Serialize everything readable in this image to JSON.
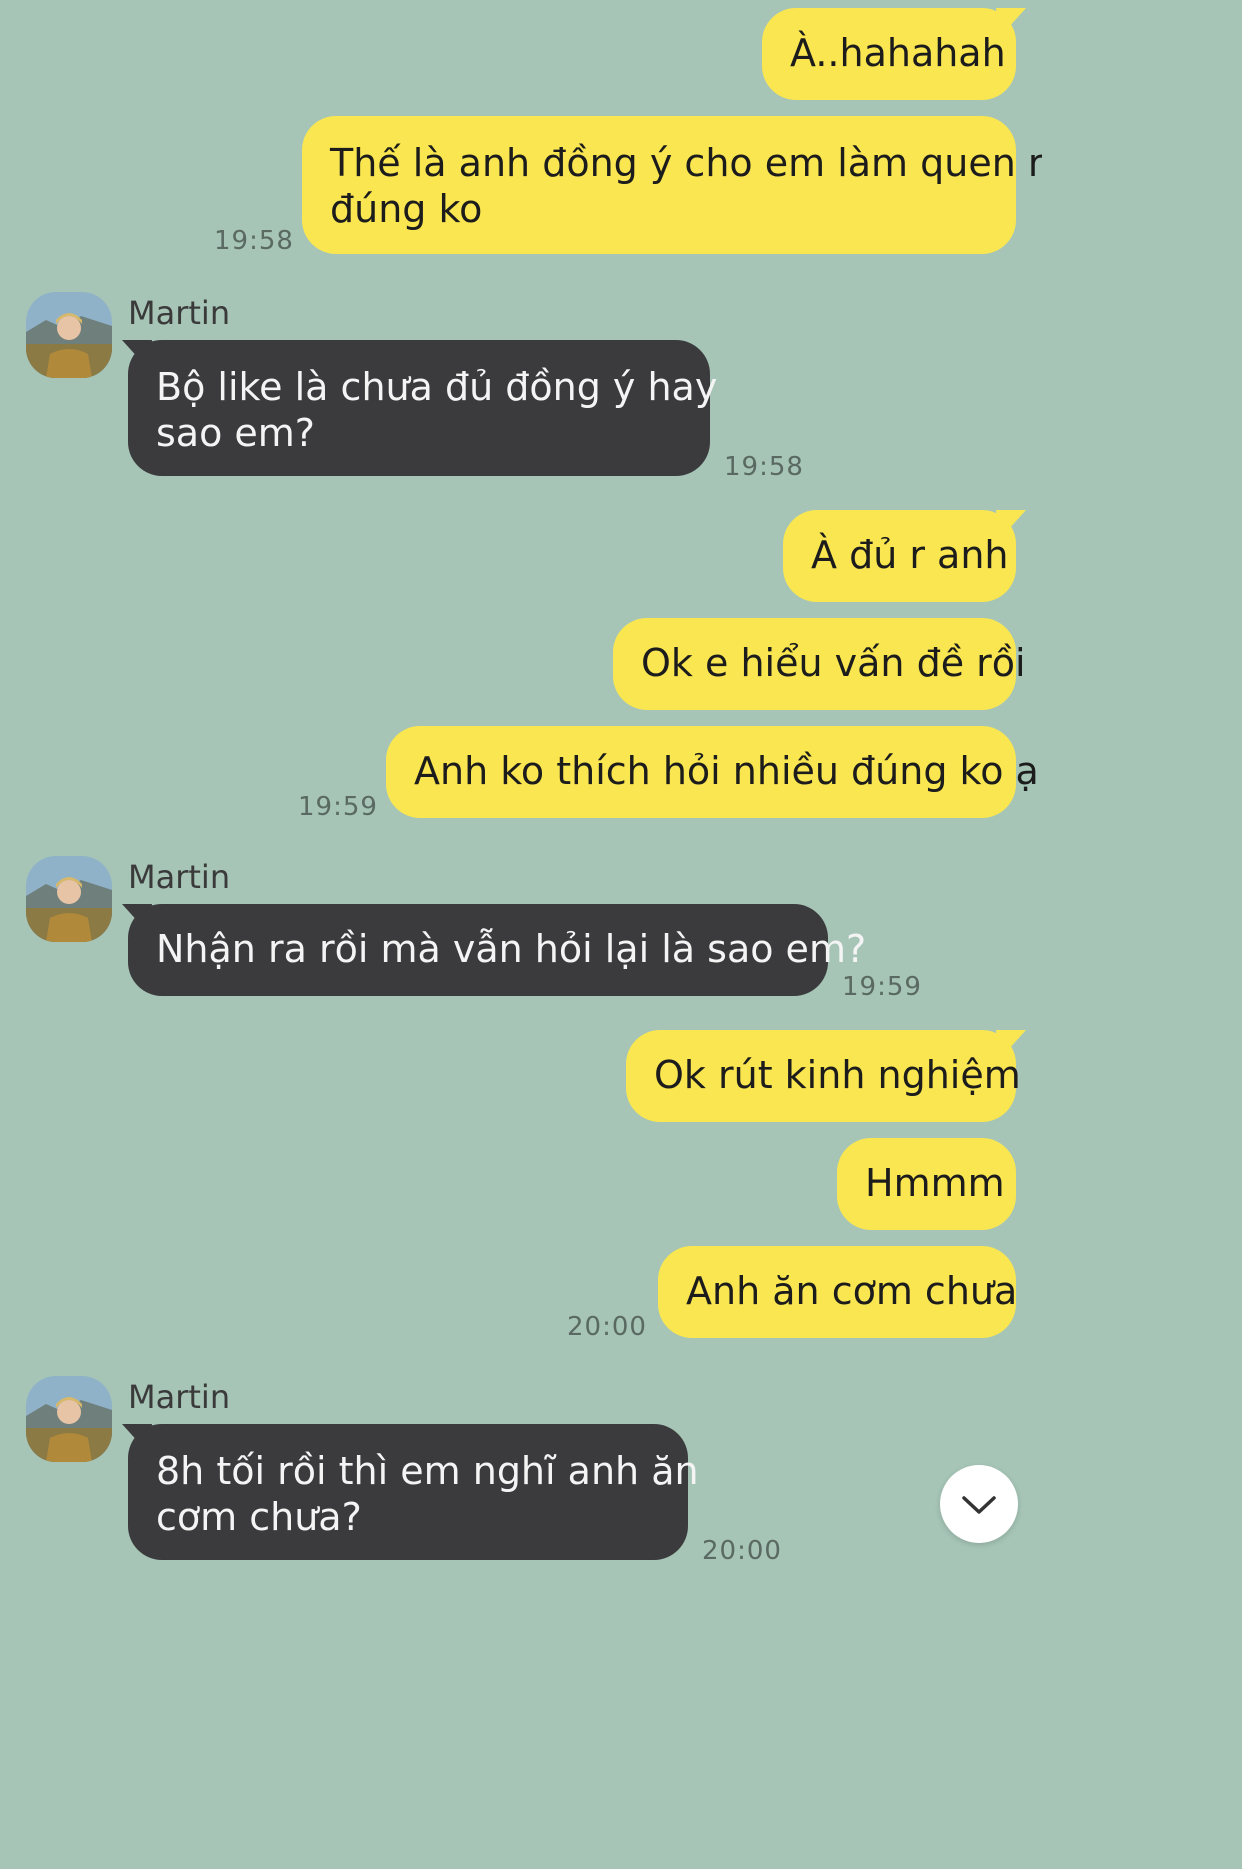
{
  "contact": {
    "name": "Martin",
    "avatar_icon": "profile-photo"
  },
  "messages": [
    {
      "dir": "out",
      "lines": [
        "À..hahahah"
      ]
    },
    {
      "dir": "out",
      "lines": [
        "Thế là anh đồng ý cho em làm quen r",
        "đúng ko"
      ],
      "time": "19:58"
    },
    {
      "dir": "in",
      "sender": "Martin",
      "lines": [
        "Bộ like là chưa đủ đồng ý hay",
        "sao em?"
      ],
      "time": "19:58"
    },
    {
      "dir": "out",
      "lines": [
        "À đủ r anh"
      ]
    },
    {
      "dir": "out",
      "lines": [
        "Ok e hiểu vấn đề rồi"
      ]
    },
    {
      "dir": "out",
      "lines": [
        "Anh ko thích hỏi nhiều đúng ko ạ"
      ],
      "time": "19:59"
    },
    {
      "dir": "in",
      "sender": "Martin",
      "lines": [
        "Nhận ra rồi mà vẫn hỏi lại là sao em?"
      ],
      "time": "19:59"
    },
    {
      "dir": "out",
      "lines": [
        "Ok rút kinh nghiệm"
      ]
    },
    {
      "dir": "out",
      "lines": [
        "Hmmm"
      ]
    },
    {
      "dir": "out",
      "lines": [
        "Anh ăn cơm chưa"
      ],
      "time": "20:00"
    },
    {
      "dir": "in",
      "sender": "Martin",
      "lines": [
        "8h tối rồi thì em nghĩ anh ăn",
        "cơm chưa?"
      ],
      "time": "20:00"
    }
  ],
  "controls": {
    "scroll_down_icon": "chevron-down-icon"
  },
  "colors": {
    "background": "#a6c5b7",
    "outgoing": "#f9e650",
    "incoming": "#3b3b3d"
  }
}
